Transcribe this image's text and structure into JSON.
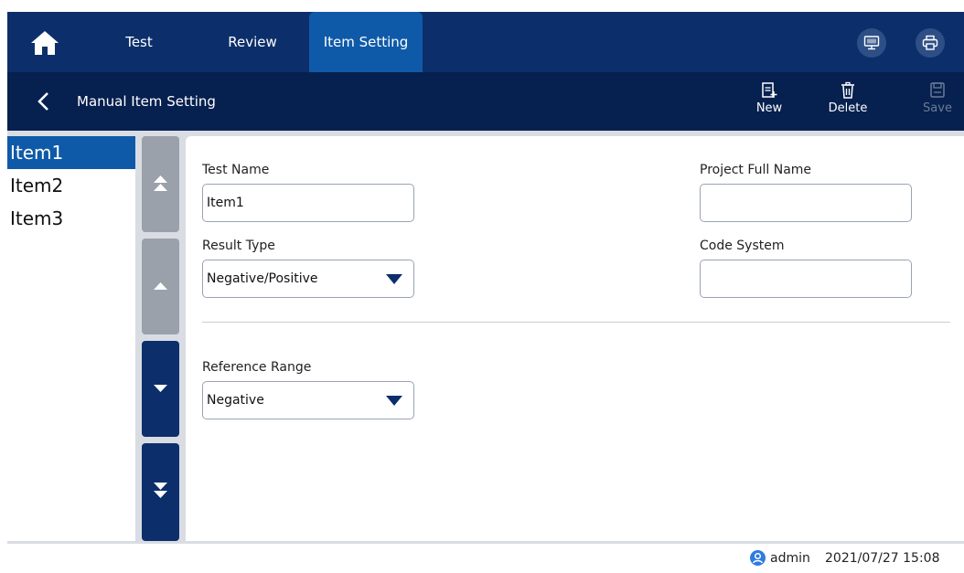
{
  "nav": {
    "tabs": [
      {
        "label": "Test",
        "active": false
      },
      {
        "label": "Review",
        "active": false
      },
      {
        "label": "Item Setting",
        "active": true
      }
    ],
    "right_icons": [
      "lis-monitor-icon",
      "printer-icon"
    ]
  },
  "header": {
    "title": "Manual Item Setting",
    "actions": {
      "new_label": "New",
      "delete_label": "Delete",
      "save_label": "Save"
    }
  },
  "item_list": {
    "items": [
      "Item1",
      "Item2",
      "Item3"
    ],
    "selected_index": 0
  },
  "form": {
    "test_name": {
      "label": "Test Name",
      "value": "Item1"
    },
    "project_full_name": {
      "label": "Project Full Name",
      "value": ""
    },
    "result_type": {
      "label": "Result Type",
      "value": "Negative/Positive"
    },
    "code_system": {
      "label": "Code System",
      "value": ""
    },
    "reference_range": {
      "label": "Reference Range",
      "value": "Negative"
    }
  },
  "status_bar": {
    "user": "admin",
    "datetime": "2021/07/27 15:08"
  },
  "colors": {
    "nav_bg": "#0c2f6b",
    "subheader_bg": "#06204f",
    "accent": "#0f5aa8",
    "disabled_button": "#9aa1ab"
  }
}
